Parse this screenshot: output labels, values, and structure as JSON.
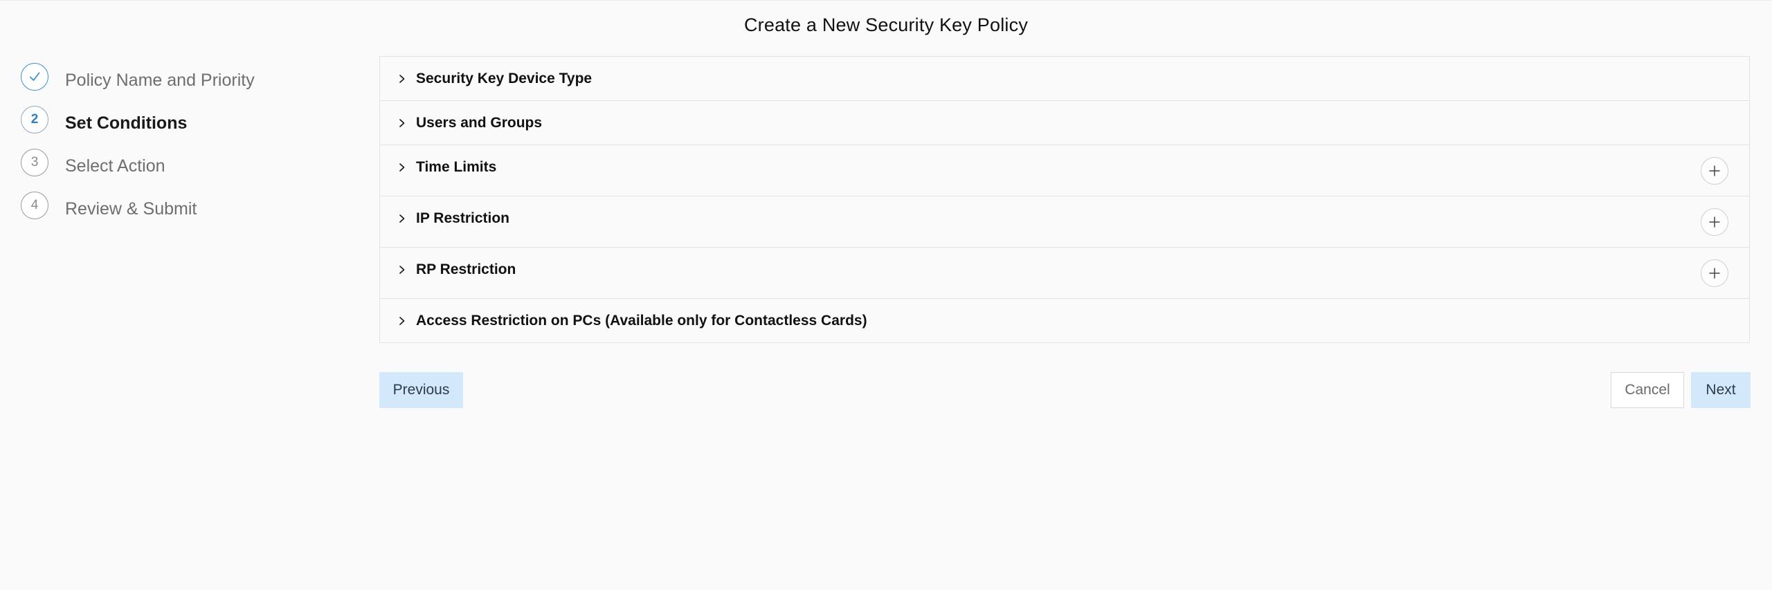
{
  "page": {
    "title": "Create a New Security Key Policy"
  },
  "stepper": {
    "steps": [
      {
        "number": "",
        "label": "Policy Name and Priority",
        "state": "done",
        "icon": "check-icon"
      },
      {
        "number": "2",
        "label": "Set Conditions",
        "state": "active"
      },
      {
        "number": "3",
        "label": "Select Action",
        "state": "pending"
      },
      {
        "number": "4",
        "label": "Review & Submit",
        "state": "pending"
      }
    ]
  },
  "conditions": {
    "sections": [
      {
        "title": "Security Key Device Type",
        "has_add": false,
        "icon": "chevron-right-icon"
      },
      {
        "title": "Users and Groups",
        "has_add": false,
        "icon": "chevron-right-icon"
      },
      {
        "title": "Time Limits",
        "has_add": true,
        "icon": "chevron-right-icon",
        "add_icon": "plus-icon"
      },
      {
        "title": "IP Restriction",
        "has_add": true,
        "icon": "chevron-right-icon",
        "add_icon": "plus-icon"
      },
      {
        "title": "RP Restriction",
        "has_add": true,
        "icon": "chevron-right-icon",
        "add_icon": "plus-icon"
      },
      {
        "title": "Access Restriction on PCs (Available only for Contactless Cards)",
        "has_add": false,
        "icon": "chevron-right-icon"
      }
    ]
  },
  "footer": {
    "previous_label": "Previous",
    "cancel_label": "Cancel",
    "next_label": "Next"
  },
  "colors": {
    "background": "#fafafa",
    "primary_button_bg": "#d3e9fb",
    "step_done_accent": "#3a8fd1",
    "step_active_number": "#2f7fc2",
    "border": "#e2e2e2"
  }
}
